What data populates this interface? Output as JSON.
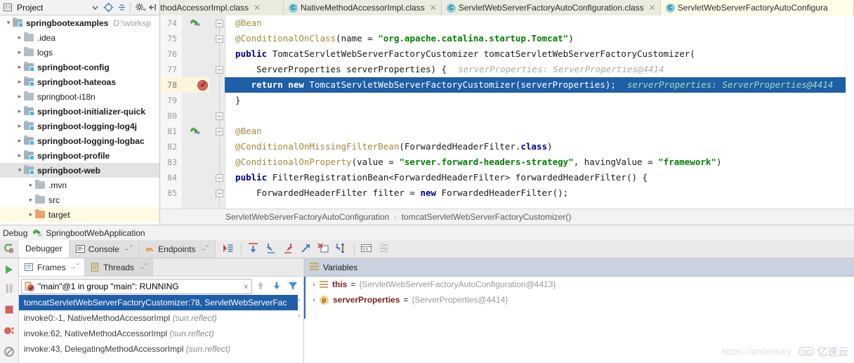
{
  "project_toolbar": {
    "label": "Project",
    "icons": [
      "project-view-icon",
      "chevron-down-icon",
      "locate-icon",
      "expand-collapse-icon",
      "settings-gear-icon",
      "hide-icon"
    ]
  },
  "editor_tabs": [
    {
      "name": "thodAccessorImpl.class",
      "active": false,
      "clipped": true,
      "closable": true
    },
    {
      "name": "NativeMethodAccessorImpl.class",
      "active": false,
      "clipped": false,
      "closable": true
    },
    {
      "name": "ServletWebServerFactoryAutoConfiguration.class",
      "active": false,
      "clipped": false,
      "closable": true
    },
    {
      "name": "ServletWebServerFactoryAutoConfigura",
      "active": true,
      "clipped": false,
      "closable": false
    }
  ],
  "project_tree": [
    {
      "label": "springbootexamples",
      "path": "D:\\worksp",
      "bold": true,
      "depth": 0,
      "arrow": "expanded",
      "folder": "module",
      "state": "normal"
    },
    {
      "label": ".idea",
      "path": "",
      "bold": false,
      "depth": 1,
      "arrow": "collapsed",
      "folder": "plain",
      "state": "normal"
    },
    {
      "label": "logs",
      "path": "",
      "bold": false,
      "depth": 1,
      "arrow": "collapsed",
      "folder": "plain",
      "state": "normal"
    },
    {
      "label": "springboot-config",
      "path": "",
      "bold": true,
      "depth": 1,
      "arrow": "collapsed",
      "folder": "module",
      "state": "normal"
    },
    {
      "label": "springboot-hateoas",
      "path": "",
      "bold": true,
      "depth": 1,
      "arrow": "collapsed",
      "folder": "module",
      "state": "normal"
    },
    {
      "label": "springboot-i18n",
      "path": "",
      "bold": false,
      "depth": 1,
      "arrow": "collapsed",
      "folder": "plain",
      "state": "normal"
    },
    {
      "label": "springboot-initializer-quick",
      "path": "",
      "bold": true,
      "depth": 1,
      "arrow": "collapsed",
      "folder": "module",
      "state": "normal"
    },
    {
      "label": "springboot-logging-log4j",
      "path": "",
      "bold": true,
      "depth": 1,
      "arrow": "collapsed",
      "folder": "module",
      "state": "normal"
    },
    {
      "label": "springboot-logging-logbac",
      "path": "",
      "bold": true,
      "depth": 1,
      "arrow": "collapsed",
      "folder": "module",
      "state": "normal"
    },
    {
      "label": "springboot-profile",
      "path": "",
      "bold": true,
      "depth": 1,
      "arrow": "collapsed",
      "folder": "module",
      "state": "normal"
    },
    {
      "label": "springboot-web",
      "path": "",
      "bold": true,
      "depth": 1,
      "arrow": "expanded",
      "folder": "module",
      "state": "selected"
    },
    {
      "label": ".mvn",
      "path": "",
      "bold": false,
      "depth": 2,
      "arrow": "collapsed",
      "folder": "plain",
      "state": "normal"
    },
    {
      "label": "src",
      "path": "",
      "bold": false,
      "depth": 2,
      "arrow": "collapsed",
      "folder": "plain",
      "state": "normal"
    },
    {
      "label": "target",
      "path": "",
      "bold": false,
      "depth": 2,
      "arrow": "collapsed",
      "folder": "orange",
      "state": "highlighted"
    }
  ],
  "editor": {
    "first_line": 74,
    "current_line": 78,
    "lines": [
      {
        "n": 74,
        "text": "    @Bean"
      },
      {
        "n": 75,
        "text": "    @ConditionalOnClass(name = \"org.apache.catalina.startup.Tomcat\")"
      },
      {
        "n": 76,
        "text": "    public TomcatServletWebServerFactoryCustomizer tomcatServletWebServerFactoryCustomizer("
      },
      {
        "n": 77,
        "text": "            ServerProperties serverProperties) {    serverProperties: ServerProperties@4414"
      },
      {
        "n": 78,
        "text": "        return new TomcatServletWebServerFactoryCustomizer(serverProperties);    serverProperties: ServerProperties@4414"
      },
      {
        "n": 79,
        "text": "    }"
      },
      {
        "n": 80,
        "text": ""
      },
      {
        "n": 81,
        "text": "    @Bean"
      },
      {
        "n": 82,
        "text": "    @ConditionalOnMissingFilterBean(ForwardedHeaderFilter.class)"
      },
      {
        "n": 83,
        "text": "    @ConditionalOnProperty(value = \"server.forward-headers-strategy\", havingValue = \"framework\")"
      },
      {
        "n": 84,
        "text": "    public FilterRegistrationBean<ForwardedHeaderFilter> forwardedHeaderFilter() {"
      },
      {
        "n": 85,
        "text": "        ForwardedHeaderFilter filter = new ForwardedHeaderFilter();"
      }
    ],
    "inline_hints": {
      "line77": "serverProperties: ServerProperties@4414",
      "line78": "serverProperties: ServerProperties@4414"
    }
  },
  "breadcrumb": {
    "class": "ServletWebServerFactoryAutoConfiguration",
    "separator": "›",
    "method": "tomcatServletWebServerFactoryCustomizer()"
  },
  "debug": {
    "window_title": "Debug",
    "run_config": "SpringbootWebApplication",
    "tabs": [
      {
        "label": "Debugger",
        "icon": "debugger-icon",
        "active": true,
        "pin": ""
      },
      {
        "label": "Console",
        "icon": "console-icon",
        "active": false,
        "pin": "→˝"
      },
      {
        "label": "Endpoints",
        "icon": "endpoints-icon",
        "active": false,
        "pin": "→˝"
      }
    ],
    "toolbar_icons": [
      "show-execution-point-icon",
      "step-over-icon",
      "step-into-icon",
      "force-step-into-icon",
      "step-out-icon",
      "drop-frame-icon",
      "run-to-cursor-icon",
      "evaluate-expression-icon",
      "settings-list-icon"
    ],
    "rerun_icon": "rerun-icon",
    "rail_icons": [
      "resume-program-icon",
      "pause-program-icon",
      "stop-icon",
      "view-breakpoints-icon",
      "mute-breakpoints-icon"
    ]
  },
  "frames_panel": {
    "tabs": [
      {
        "label": "Frames",
        "icon": "frames-icon",
        "active": true,
        "pin": "→˝"
      },
      {
        "label": "Threads",
        "icon": "threads-icon",
        "active": false,
        "pin": "→˝"
      }
    ],
    "thread_selector": {
      "value": "\"main\"@1 in group \"main\": RUNNING",
      "icon": "thread-running-icon",
      "chevron": "∨"
    },
    "nav_icons": [
      "frame-up-icon",
      "frame-down-icon",
      "filter-icon"
    ],
    "frames": [
      {
        "text": "tomcatServletWebServerFactoryCustomizer:78, ServletWebServerFac",
        "pkg": "",
        "selected": true
      },
      {
        "text": "invoke0:-1, NativeMethodAccessorImpl ",
        "pkg": "(sun.reflect)",
        "selected": false
      },
      {
        "text": "invoke:62, NativeMethodAccessorImpl ",
        "pkg": "(sun.reflect)",
        "selected": false
      },
      {
        "text": "invoke:43, DelegatingMethodAccessorImpl ",
        "pkg": "(sun.reflect)",
        "selected": false
      }
    ]
  },
  "variables_panel": {
    "title": "Variables",
    "title_icon": "variables-icon",
    "rows": [
      {
        "arrow": "›",
        "icon": "object-icon",
        "name": "this",
        "eq": "=",
        "value": "{ServletWebServerFactoryAutoConfiguration@4413}"
      },
      {
        "arrow": "›",
        "icon": "parameter-icon",
        "name": "serverProperties",
        "eq": "=",
        "value": "{ServerProperties@4414}"
      }
    ]
  },
  "watermark": {
    "url": "https://smilenicky",
    "brand": "亿速云"
  },
  "colors": {
    "selection_blue": "#1f5ea8",
    "current_line_yellow": "#fdf6dd",
    "tab_bg": "#ecebdf",
    "active_tab_bg": "#fffce8",
    "vars_header": "#c9d2de",
    "breakpoint_red": "#d9615c"
  }
}
